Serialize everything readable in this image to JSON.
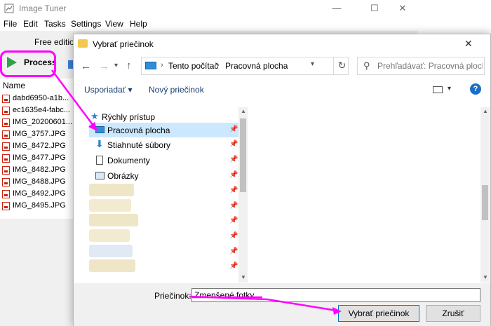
{
  "app": {
    "title": "Image Tuner",
    "menu": [
      "File",
      "Edit",
      "Tasks",
      "Settings",
      "View",
      "Help"
    ],
    "edition": "Free edition",
    "process_label": "Process",
    "file_list_header": "Name",
    "files": [
      "dabd6950-a1b...",
      "ec1635e4-fabc...",
      "IMG_20200601...",
      "IMG_3757.JPG",
      "IMG_8472.JPG",
      "IMG_8477.JPG",
      "IMG_8482.JPG",
      "IMG_8488.JPG",
      "IMG_8492.JPG",
      "IMG_8495.JPG"
    ],
    "window_controls": {
      "minimize": "—",
      "maximize": "☐",
      "close": "✕"
    }
  },
  "dialog": {
    "title": "Vybrať priečinok",
    "close": "✕",
    "address": [
      "Tento počítač",
      "Pracovná plocha"
    ],
    "search_placeholder": "Prehľadávať: Pracovná plocha",
    "organize_label": "Usporiadať ▾",
    "new_folder_label": "Nový priečinok",
    "help_label": "?",
    "tree": {
      "quick_access": "Rýchly prístup",
      "items": [
        "Pracovná plocha",
        "Stiahnuté súbory",
        "Dokumenty",
        "Obrázky"
      ],
      "selected": "Pracovná plocha"
    },
    "folder_label": "Priečinok:",
    "folder_value": "Zmenšené fotky",
    "select_button": "Vybrať priečinok",
    "cancel_button": "Zrušiť"
  },
  "colors": {
    "highlight": "#ff00ff",
    "selection": "#cce8ff",
    "accent": "#0078d7",
    "play": "#2fa34a"
  }
}
